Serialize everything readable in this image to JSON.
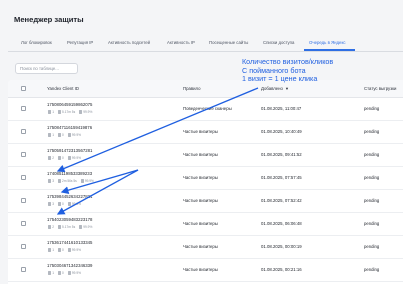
{
  "app": {
    "title": "Менеджер защиты"
  },
  "tabs": [
    {
      "label": "Лог блокировок",
      "active": false
    },
    {
      "label": "Репутация IP",
      "active": false
    },
    {
      "label": "Активность подсетей",
      "active": false
    },
    {
      "label": "Активность IP",
      "active": false
    },
    {
      "label": "Посещенные сайты",
      "active": false
    },
    {
      "label": "Списки доступа",
      "active": false
    },
    {
      "label": "Очередь в Яндекс",
      "active": true
    }
  ],
  "filter": {
    "placeholder": "Поиск по таблице..."
  },
  "table": {
    "headers": {
      "client_id": "Yandex Client ID",
      "rule": "Правило",
      "added": "Добавлено",
      "status": "Статус выгрузки",
      "added_sort": "▼"
    },
    "rows": [
      {
        "client_id": "1750806459159862075",
        "s1": "1",
        "s2": "5.17m 5s",
        "s3": "99.9%",
        "rule": "Поведенческие сканеры",
        "added": "01.08.2025, 11:00:47",
        "status": "pending"
      },
      {
        "client_id": "1750847116159419876",
        "s1": "1",
        "s2": "0",
        "s3": "99.9%",
        "rule": "Частые визитеры",
        "added": "01.08.2025, 10:40:49",
        "status": "pending"
      },
      {
        "client_id": "1750591472313567281",
        "s1": "2",
        "s2": "0",
        "s3": "99.9%",
        "rule": "Частые визитеры",
        "added": "01.08.2025, 09:41:52",
        "status": "pending"
      },
      {
        "client_id": "1740851198533389233",
        "s1": "3",
        "s2": "2m 56s 5s",
        "s3": "99.9%",
        "rule": "Частые визитеры",
        "added": "01.08.2025, 07:57:45",
        "status": "pending"
      },
      {
        "client_id": "1753984452634227821",
        "s1": "3",
        "s2": "0",
        "s3": "99.9%",
        "rule": "Частые визитеры",
        "added": "01.08.2025, 07:52:42",
        "status": "pending"
      },
      {
        "client_id": "1754023059483223178",
        "s1": "2",
        "s2": "5.17m 5s",
        "s3": "99.9%",
        "rule": "Частые визитеры",
        "added": "01.08.2025, 06:06:48",
        "status": "pending"
      },
      {
        "client_id": "1753617441610133345",
        "s1": "1",
        "s2": "0",
        "s3": "99.9%",
        "rule": "Частые визитеры",
        "added": "01.08.2025, 00:00:19",
        "status": "pending"
      },
      {
        "client_id": "1750304671342346339",
        "s1": "1",
        "s2": "0",
        "s3": "99.9%",
        "rule": "Частые визитеры",
        "added": "01.08.2025, 00:21:16",
        "status": "pending"
      }
    ]
  },
  "annotation": {
    "line1": "Количество визитов/кликов",
    "line2": "С пойманного бота",
    "line3": "1 визит = 1 цене клика",
    "color": "#1f5fe0"
  },
  "colors": {
    "accent": "#2f6fe4",
    "annotation": "#1f5fe0"
  },
  "icons": [
    "visits-icon",
    "time-icon",
    "bot-score-icon"
  ]
}
